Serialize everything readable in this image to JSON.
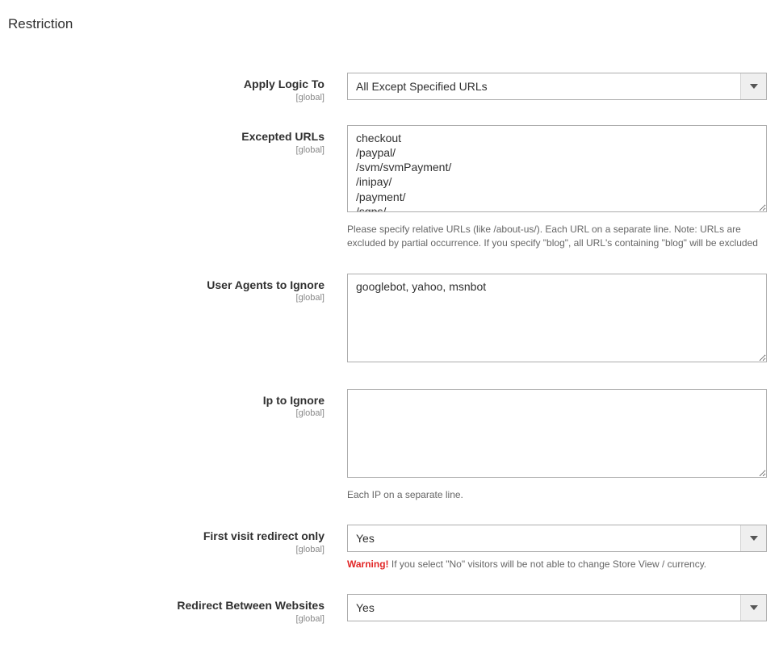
{
  "section": {
    "title": "Restriction"
  },
  "scopeLabel": "[global]",
  "fields": {
    "applyLogic": {
      "label": "Apply Logic To",
      "value": "All Except Specified URLs"
    },
    "exceptedUrls": {
      "label": "Excepted URLs",
      "value": "checkout\n/paypal/\n/svm/svmPayment/\n/inipay/\n/payment/\n/sgps/",
      "note": "Please specify relative URLs (like /about-us/). Each URL on a separate line. Note: URLs are excluded by partial occurrence. If you specify \"blog\", all URL's containing \"blog\" will be excluded"
    },
    "userAgents": {
      "label": "User Agents to Ignore",
      "value": "googlebot, yahoo, msnbot"
    },
    "ipIgnore": {
      "label": "Ip to Ignore",
      "value": "",
      "note": "Each IP on a separate line."
    },
    "firstVisit": {
      "label": "First visit redirect only",
      "value": "Yes",
      "warnLabel": "Warning!",
      "warnText": " If you select \"No\" visitors will be not able to change Store View / currency."
    },
    "redirectBetween": {
      "label": "Redirect Between Websites",
      "value": "Yes"
    }
  }
}
